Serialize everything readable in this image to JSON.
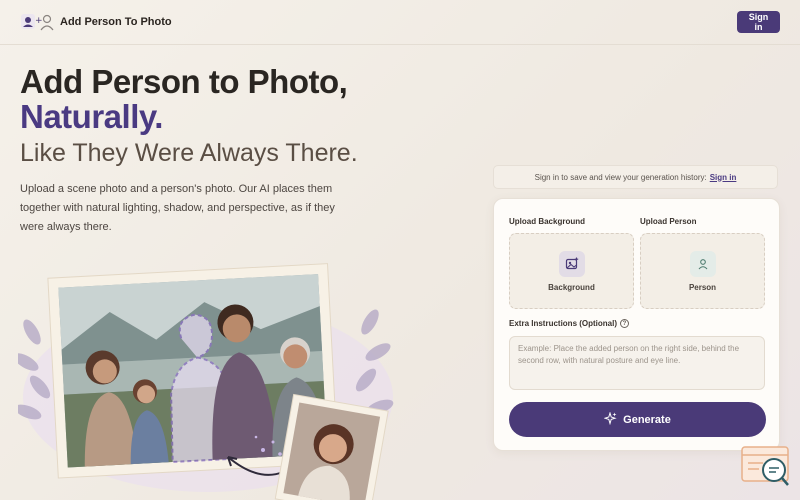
{
  "header": {
    "title": "Add Person To Photo",
    "signin_label": "Sign in"
  },
  "hero": {
    "title_line1": "Add Person to Photo,",
    "title_line2": "Naturally.",
    "subtitle": "Like They Were Always There.",
    "description": "Upload a scene photo and a person's photo. Our AI places them together with natural lighting, shadow, and perspective, as if they were always there."
  },
  "history": {
    "text": "Sign in to save and view your generation history:",
    "link": "Sign in"
  },
  "form": {
    "background_label": "Upload Background",
    "person_label": "Upload Person",
    "background_tile": "Background",
    "person_tile": "Person",
    "instructions_label": "Extra Instructions (Optional)",
    "help_glyph": "?",
    "instructions_placeholder": "Example: Place the added person on the right side, behind the second row, with natural posture and eye line.",
    "generate_label": "Generate"
  },
  "colors": {
    "accent": "#4a3a78",
    "accent_text": "#4a3a82"
  },
  "icons": [
    "add-person-logo-icon",
    "image-icon",
    "person-icon",
    "help-icon",
    "sparkle-icon",
    "support-chat-icon"
  ]
}
